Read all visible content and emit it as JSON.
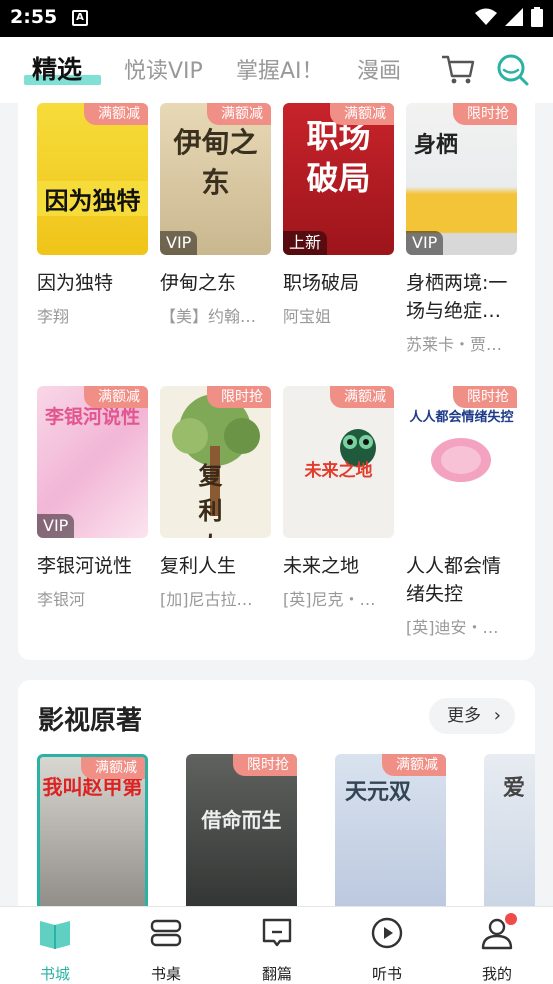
{
  "status": {
    "time": "2:55",
    "a_icon": "A"
  },
  "tabs": [
    "精选",
    "悦读VIP",
    "掌握AI！",
    "漫画"
  ],
  "books_row1": [
    {
      "cover_text": "因为独特",
      "tag": "满额减",
      "badge": "",
      "title": "因为独特",
      "author": "李翔"
    },
    {
      "cover_text": "伊甸之东",
      "tag": "满额减",
      "badge": "VIP",
      "title": "伊甸之东",
      "author": "【美】约翰…"
    },
    {
      "cover_text": "职场破局",
      "tag": "满额减",
      "badge": "上新",
      "title": "职场破局",
      "author": "阿宝姐"
    },
    {
      "cover_text": "身栖",
      "tag": "限时抢",
      "badge": "VIP",
      "title": "身栖两境:一场与绝症…",
      "author": "苏莱卡・贾…"
    }
  ],
  "books_row2": [
    {
      "cover_text": "李银河说性",
      "tag": "满额减",
      "badge": "VIP",
      "title": "李银河说性",
      "author": "李银河"
    },
    {
      "cover_text": "复利人生",
      "tag": "限时抢",
      "badge": "",
      "title": "复利人生",
      "author": "[加]尼古拉…"
    },
    {
      "cover_text": "未来之地",
      "tag": "满额减",
      "badge": "",
      "title": "未来之地",
      "author": "[英]尼克・…"
    },
    {
      "cover_text": "人人都会情绪失控",
      "tag": "限时抢",
      "badge": "",
      "title": "人人都会情绪失控",
      "author": "[英]迪安・…"
    }
  ],
  "section2": {
    "title": "影视原著",
    "more": "更多",
    "books": [
      {
        "cover_text": "我叫赵甲第",
        "tag": "满额减"
      },
      {
        "cover_text": "借命而生",
        "tag": "限时抢"
      },
      {
        "cover_text": "天元双",
        "tag": "满额减"
      },
      {
        "cover_text": "爱",
        "tag": ""
      }
    ]
  },
  "bottom_nav": [
    "书城",
    "书桌",
    "翻篇",
    "听书",
    "我的"
  ],
  "colors": {
    "accent": "#2ab3a4",
    "tag": "#f08f86",
    "underline": "#7fe0d3"
  }
}
